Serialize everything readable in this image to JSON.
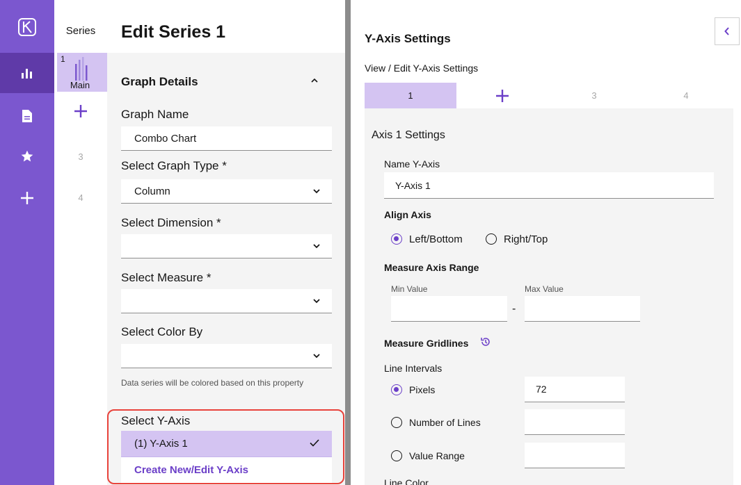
{
  "rail": {
    "items": [
      {
        "icon": "logo-icon"
      },
      {
        "icon": "bar-chart-icon",
        "active": true
      },
      {
        "icon": "document-icon"
      },
      {
        "icon": "star-icon"
      },
      {
        "icon": "plus-icon"
      }
    ]
  },
  "series": {
    "header": "Series",
    "cards": [
      {
        "number": "1",
        "label": "Main",
        "selected": true
      }
    ],
    "add_icon": "plus-icon",
    "slots": [
      "3",
      "4"
    ]
  },
  "edit": {
    "title": "Edit Series 1",
    "section_title": "Graph Details",
    "fields": {
      "graph_name_label": "Graph Name",
      "graph_name_value": "Combo Chart",
      "graph_type_label": "Select Graph Type *",
      "graph_type_value": "Column",
      "dimension_label": "Select Dimension *",
      "dimension_value": "",
      "measure_label": "Select Measure *",
      "measure_value": "",
      "color_by_label": "Select Color By",
      "color_by_value": "",
      "color_by_helper": "Data series will be colored based on this property",
      "yaxis_label": "Select Y-Axis"
    },
    "yaxis_options": {
      "selected": "(1) Y-Axis 1",
      "create": "Create New/Edit Y-Axis"
    }
  },
  "yaxis": {
    "title": "Y-Axis Settings",
    "subtitle": "View / Edit Y-Axis Settings",
    "tabs": [
      "1",
      "+",
      "3",
      "4"
    ],
    "active_tab": "1",
    "axis_title": "Axis 1 Settings",
    "name_label": "Name Y-Axis",
    "name_value": "Y-Axis 1",
    "align_label": "Align Axis",
    "align_options": [
      "Left/Bottom",
      "Right/Top"
    ],
    "align_selected": "Left/Bottom",
    "range_label": "Measure Axis Range",
    "min_label": "Min Value",
    "max_label": "Max Value",
    "min_value": "",
    "max_value": "",
    "range_separator": "-",
    "gridlines_label": "Measure Gridlines",
    "intervals_label": "Line Intervals",
    "interval_options": [
      "Pixels",
      "Number of Lines",
      "Value Range"
    ],
    "interval_selected": "Pixels",
    "pixels_value": "72",
    "lines_value": "",
    "range_value": "",
    "line_color_label": "Line Color"
  },
  "colors": {
    "rail": "#7b57cf",
    "rail_active": "#5f3aa8",
    "accent": "#6b3fc8",
    "selected_bg": "#d4c4f2",
    "highlight_border": "#e8423a"
  }
}
